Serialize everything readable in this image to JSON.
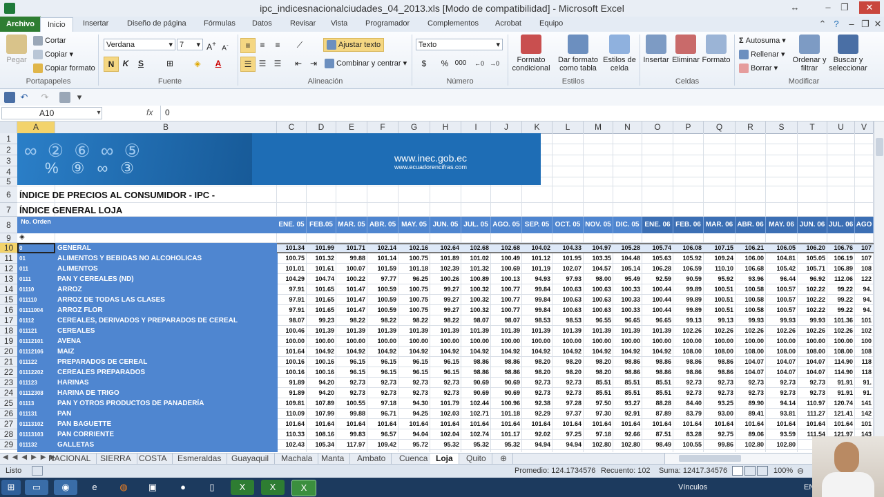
{
  "window": {
    "title": "ipc_indicesnacionalciudades_04_2013.xls  [Modo de compatibilidad]  -  Microsoft Excel"
  },
  "ribbon_tabs": [
    "Archivo",
    "Inicio",
    "Insertar",
    "Diseño de página",
    "Fórmulas",
    "Datos",
    "Revisar",
    "Vista",
    "Programador",
    "Complementos",
    "Acrobat",
    "Equipo"
  ],
  "ribbon": {
    "clipboard": {
      "paste": "Pegar",
      "cut": "Cortar",
      "copy": "Copiar",
      "format_painter": "Copiar formato",
      "label": "Portapapeles"
    },
    "font": {
      "name": "Verdana",
      "size": "7",
      "label": "Fuente",
      "bold": "N",
      "italic": "K",
      "underline": "S"
    },
    "alignment": {
      "wrap": "Ajustar texto",
      "merge": "Combinar y centrar",
      "label": "Alineación"
    },
    "number": {
      "format": "Texto",
      "currency": "$",
      "percent": "%",
      "thousands": "000",
      "label": "Número"
    },
    "styles": {
      "conditional": "Formato condicional",
      "table": "Dar formato como tabla",
      "cell_styles": "Estilos de celda",
      "label": "Estilos"
    },
    "cells": {
      "insert": "Insertar",
      "delete": "Eliminar",
      "format": "Formato",
      "label": "Celdas"
    },
    "editing": {
      "autosum": "Autosuma",
      "fill": "Rellenar",
      "clear": "Borrar",
      "sort": "Ordenar y filtrar",
      "find": "Buscar y seleccionar",
      "label": "Modificar"
    }
  },
  "formula_bar": {
    "name_box": "A10",
    "fx": "fx",
    "value": "0"
  },
  "columns": [
    "A",
    "B",
    "C",
    "D",
    "E",
    "F",
    "G",
    "H",
    "I",
    "J",
    "K",
    "L",
    "M",
    "N",
    "O",
    "P",
    "Q",
    "R",
    "S",
    "T",
    "U",
    "V"
  ],
  "row_numbers": [
    "1",
    "2",
    "3",
    "4",
    "5",
    "6",
    "7",
    "8",
    "9",
    "10",
    "11",
    "12",
    "13",
    "14",
    "15",
    "16",
    "17",
    "18",
    "19",
    "20",
    "21",
    "22",
    "23",
    "24",
    "25",
    "26",
    "27",
    "28",
    "29"
  ],
  "banner": {
    "url": "www.inec.gob.ec",
    "sub": "www.ecuadorencifras.com"
  },
  "titles": {
    "line1": "ÍNDICE DE PRECIOS AL CONSUMIDOR - IPC -",
    "line2": "ÍNDICE GENERAL LOJA"
  },
  "header": {
    "no_orden": "No. Orden",
    "months": [
      "ENE. 05",
      "FEB.05",
      "MAR. 05",
      "ABR. 05",
      "MAY. 05",
      "JUN. 05",
      "JUL. 05",
      "AGO. 05",
      "SEP. 05",
      "OCT. 05",
      "NOV. 05",
      "DIC. 05",
      "ENE. 06",
      "FEB. 06",
      "MAR. 06",
      "ABR. 06",
      "MAY. 06",
      "JUN. 06",
      "JUL. 06",
      "AGO"
    ]
  },
  "rows": [
    {
      "code": "0",
      "name": "GENERAL",
      "values": [
        "101.34",
        "101.99",
        "101.71",
        "102.14",
        "102.16",
        "102.64",
        "102.68",
        "102.68",
        "104.02",
        "104.33",
        "104.97",
        "105.28",
        "105.74",
        "106.08",
        "107.15",
        "106.21",
        "106.05",
        "106.20",
        "106.76",
        "107"
      ]
    },
    {
      "code": "01",
      "name": "ALIMENTOS Y BEBIDAS NO ALCOHOLICAS",
      "values": [
        "100.75",
        "101.32",
        "99.88",
        "101.14",
        "100.75",
        "101.89",
        "101.02",
        "100.49",
        "101.12",
        "101.95",
        "103.35",
        "104.48",
        "105.63",
        "105.92",
        "109.24",
        "106.00",
        "104.81",
        "105.05",
        "106.19",
        "107"
      ]
    },
    {
      "code": "011",
      "name": "ALIMENTOS",
      "values": [
        "101.01",
        "101.61",
        "100.07",
        "101.59",
        "101.18",
        "102.39",
        "101.32",
        "100.69",
        "101.19",
        "102.07",
        "104.57",
        "105.14",
        "106.28",
        "106.59",
        "110.10",
        "106.68",
        "105.42",
        "105.71",
        "106.89",
        "108"
      ]
    },
    {
      "code": "0111",
      "name": "PAN Y CEREALES (ND)",
      "values": [
        "104.29",
        "104.74",
        "100.22",
        "97.77",
        "96.25",
        "100.26",
        "100.89",
        "100.13",
        "94.93",
        "97.93",
        "98.00",
        "95.49",
        "92.59",
        "90.59",
        "95.92",
        "93.96",
        "96.44",
        "96.92",
        "112.06",
        "122"
      ]
    },
    {
      "code": "01110",
      "name": "ARROZ",
      "values": [
        "97.91",
        "101.65",
        "101.47",
        "100.59",
        "100.75",
        "99.27",
        "100.32",
        "100.77",
        "99.84",
        "100.63",
        "100.63",
        "100.33",
        "100.44",
        "99.89",
        "100.51",
        "100.58",
        "100.57",
        "102.22",
        "99.22",
        "94."
      ]
    },
    {
      "code": "011110",
      "name": "ARROZ DE TODAS LAS CLASES",
      "values": [
        "97.91",
        "101.65",
        "101.47",
        "100.59",
        "100.75",
        "99.27",
        "100.32",
        "100.77",
        "99.84",
        "100.63",
        "100.63",
        "100.33",
        "100.44",
        "99.89",
        "100.51",
        "100.58",
        "100.57",
        "102.22",
        "99.22",
        "94."
      ]
    },
    {
      "code": "01111004",
      "name": "ARROZ FLOR",
      "values": [
        "97.91",
        "101.65",
        "101.47",
        "100.59",
        "100.75",
        "99.27",
        "100.32",
        "100.77",
        "99.84",
        "100.63",
        "100.63",
        "100.33",
        "100.44",
        "99.89",
        "100.51",
        "100.58",
        "100.57",
        "102.22",
        "99.22",
        "94."
      ]
    },
    {
      "code": "01112",
      "name": "CEREALES, DERIVADOS Y PREPARADOS DE CEREAL",
      "values": [
        "98.07",
        "99.23",
        "98.22",
        "98.22",
        "98.22",
        "98.22",
        "98.07",
        "98.07",
        "98.53",
        "98.53",
        "96.55",
        "96.65",
        "96.65",
        "99.13",
        "99.13",
        "99.93",
        "99.93",
        "99.93",
        "101.36",
        "101"
      ]
    },
    {
      "code": "011121",
      "name": "CEREALES",
      "values": [
        "100.46",
        "101.39",
        "101.39",
        "101.39",
        "101.39",
        "101.39",
        "101.39",
        "101.39",
        "101.39",
        "101.39",
        "101.39",
        "101.39",
        "101.39",
        "102.26",
        "102.26",
        "102.26",
        "102.26",
        "102.26",
        "102.26",
        "102"
      ]
    },
    {
      "code": "01112101",
      "name": "AVENA",
      "values": [
        "100.00",
        "100.00",
        "100.00",
        "100.00",
        "100.00",
        "100.00",
        "100.00",
        "100.00",
        "100.00",
        "100.00",
        "100.00",
        "100.00",
        "100.00",
        "100.00",
        "100.00",
        "100.00",
        "100.00",
        "100.00",
        "100.00",
        "100"
      ]
    },
    {
      "code": "01112106",
      "name": "MAIZ",
      "values": [
        "101.64",
        "104.92",
        "104.92",
        "104.92",
        "104.92",
        "104.92",
        "104.92",
        "104.92",
        "104.92",
        "104.92",
        "104.92",
        "104.92",
        "104.92",
        "108.00",
        "108.00",
        "108.00",
        "108.00",
        "108.00",
        "108.00",
        "108"
      ]
    },
    {
      "code": "011122",
      "name": "PREPARADOS DE CEREAL",
      "values": [
        "100.16",
        "100.16",
        "96.15",
        "96.15",
        "96.15",
        "96.15",
        "98.86",
        "98.86",
        "98.20",
        "98.20",
        "98.20",
        "98.86",
        "98.86",
        "98.86",
        "98.86",
        "104.07",
        "104.07",
        "104.07",
        "114.90",
        "118"
      ]
    },
    {
      "code": "01112202",
      "name": "CEREALES PREPARADOS",
      "values": [
        "100.16",
        "100.16",
        "96.15",
        "96.15",
        "96.15",
        "96.15",
        "98.86",
        "98.86",
        "98.20",
        "98.20",
        "98.20",
        "98.86",
        "98.86",
        "98.86",
        "98.86",
        "104.07",
        "104.07",
        "104.07",
        "114.90",
        "118"
      ]
    },
    {
      "code": "011123",
      "name": "HARINAS",
      "values": [
        "91.89",
        "94.20",
        "92.73",
        "92.73",
        "92.73",
        "92.73",
        "90.69",
        "90.69",
        "92.73",
        "92.73",
        "85.51",
        "85.51",
        "85.51",
        "92.73",
        "92.73",
        "92.73",
        "92.73",
        "92.73",
        "91.91",
        "91."
      ]
    },
    {
      "code": "01112308",
      "name": "HARINA DE TRIGO",
      "values": [
        "91.89",
        "94.20",
        "92.73",
        "92.73",
        "92.73",
        "92.73",
        "90.69",
        "90.69",
        "92.73",
        "92.73",
        "85.51",
        "85.51",
        "85.51",
        "92.73",
        "92.73",
        "92.73",
        "92.73",
        "92.73",
        "91.91",
        "91."
      ]
    },
    {
      "code": "01113",
      "name": "PAN Y OTROS PRODUCTOS DE PANADERÍA",
      "values": [
        "109.81",
        "107.89",
        "100.55",
        "97.18",
        "94.30",
        "101.79",
        "102.44",
        "100.96",
        "92.38",
        "97.28",
        "97.50",
        "93.27",
        "88.28",
        "84.40",
        "93.25",
        "89.90",
        "94.14",
        "110.97",
        "120.74",
        "141"
      ]
    },
    {
      "code": "011131",
      "name": "PAN",
      "values": [
        "110.09",
        "107.99",
        "99.88",
        "96.71",
        "94.25",
        "102.03",
        "102.71",
        "101.18",
        "92.29",
        "97.37",
        "97.30",
        "92.91",
        "87.89",
        "83.79",
        "93.00",
        "89.41",
        "93.81",
        "111.27",
        "121.41",
        "142"
      ]
    },
    {
      "code": "01113102",
      "name": "PAN BAGUETTE",
      "values": [
        "101.64",
        "101.64",
        "101.64",
        "101.64",
        "101.64",
        "101.64",
        "101.64",
        "101.64",
        "101.64",
        "101.64",
        "101.64",
        "101.64",
        "101.64",
        "101.64",
        "101.64",
        "101.64",
        "101.64",
        "101.64",
        "101.64",
        "101"
      ]
    },
    {
      "code": "01113103",
      "name": "PAN CORRIENTE",
      "values": [
        "110.33",
        "108.16",
        "99.83",
        "96.57",
        "94.04",
        "102.04",
        "102.74",
        "101.17",
        "92.02",
        "97.25",
        "97.18",
        "92.66",
        "87.51",
        "83.28",
        "92.75",
        "89.06",
        "93.59",
        "111.54",
        "121.97",
        "143"
      ]
    },
    {
      "code": "011132",
      "name": "GALLETAS",
      "values": [
        "102.43",
        "105.34",
        "117.97",
        "109.42",
        "95.72",
        "95.32",
        "95.32",
        "95.32",
        "94.94",
        "94.94",
        "102.80",
        "102.80",
        "98.49",
        "100.55",
        "99.86",
        "102.80",
        "102.80",
        "103",
        "",
        ""
      ]
    }
  ],
  "sheets": [
    "NACIONAL",
    "SIERRA",
    "COSTA",
    "Esmeraldas",
    "Guayaquil",
    "Machala",
    "Manta",
    "Ambato",
    "Cuenca",
    "Loja",
    "Quito"
  ],
  "active_sheet": "Loja",
  "status": {
    "ready": "Listo",
    "average": "Promedio: 124.1734576",
    "count": "Recuento: 102",
    "sum": "Suma: 12417.34576",
    "zoom": "100%"
  },
  "taskbar": {
    "links": "Vínculos",
    "lang": "EN"
  },
  "colors": {
    "accent": "#4f86d0",
    "banner": "#1e6db5",
    "file_tab": "#2e7d32"
  }
}
